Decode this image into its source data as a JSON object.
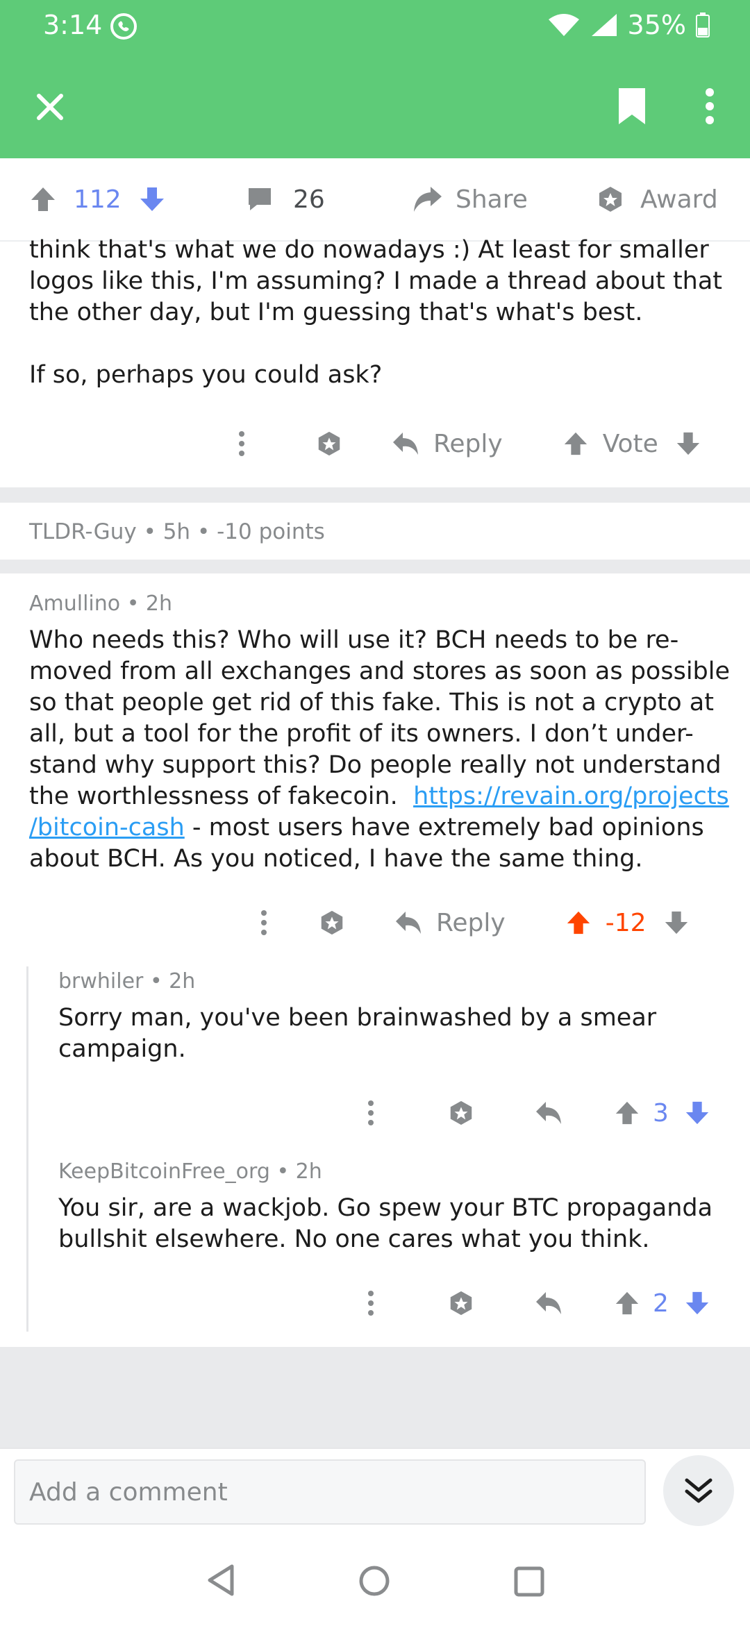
{
  "status": {
    "time": "3:14",
    "battery": "35%"
  },
  "post_actions": {
    "upvotes": "112",
    "comments": "26",
    "share": "Share",
    "award": "Award"
  },
  "partial_comment": {
    "lines": [
      "think that's what we do nowadays :) At least for smaller",
      "logos like this, I'm assuming? I made a thread about that",
      "the other day, but I'm guessing that's what's best.",
      "",
      "If so, perhaps you could ask?"
    ],
    "reply": "Reply",
    "vote": "Vote"
  },
  "collapsed": {
    "author": "TLDR-Guy",
    "age": "5h",
    "points": "-10 points"
  },
  "comment_main": {
    "author": "Amullino",
    "age": "2h",
    "lines": [
      "Who needs this? Who will use it? BCH needs to be re-",
      "moved from all exchanges and stores as soon as possible",
      "so that people get rid of this fake. This is not a crypto at",
      "all, but a tool for the profit of its owners. I don’t under-",
      "stand why support this? Do people really not understand",
      "the worthlessness of fakecoin."
    ],
    "link_part1": "https://revain.org/projects",
    "link_part2": "/bitcoin-cash",
    "after_link": " - most users have extremely bad opinions",
    "last_line": "about BCH. As you noticed, I have the same thing.",
    "reply": "Reply",
    "score": "-12"
  },
  "reply1": {
    "author": "brwhiler",
    "age": "2h",
    "lines": [
      "Sorry man, you've been brainwashed by a smear",
      "campaign."
    ],
    "score": "3"
  },
  "reply2": {
    "author": "KeepBitcoinFree_org",
    "age": "2h",
    "lines": [
      "You sir, are a wackjob. Go spew your BTC propaganda",
      "bullshit elsewhere. No one cares what you think."
    ],
    "score": "2"
  },
  "composer": {
    "placeholder": "Add a comment"
  },
  "colors": {
    "header_green": "#5ecb78",
    "upvote_blue": "#6a87f0",
    "downvote_red": "#ff4500",
    "link_blue": "#2a9df4"
  }
}
